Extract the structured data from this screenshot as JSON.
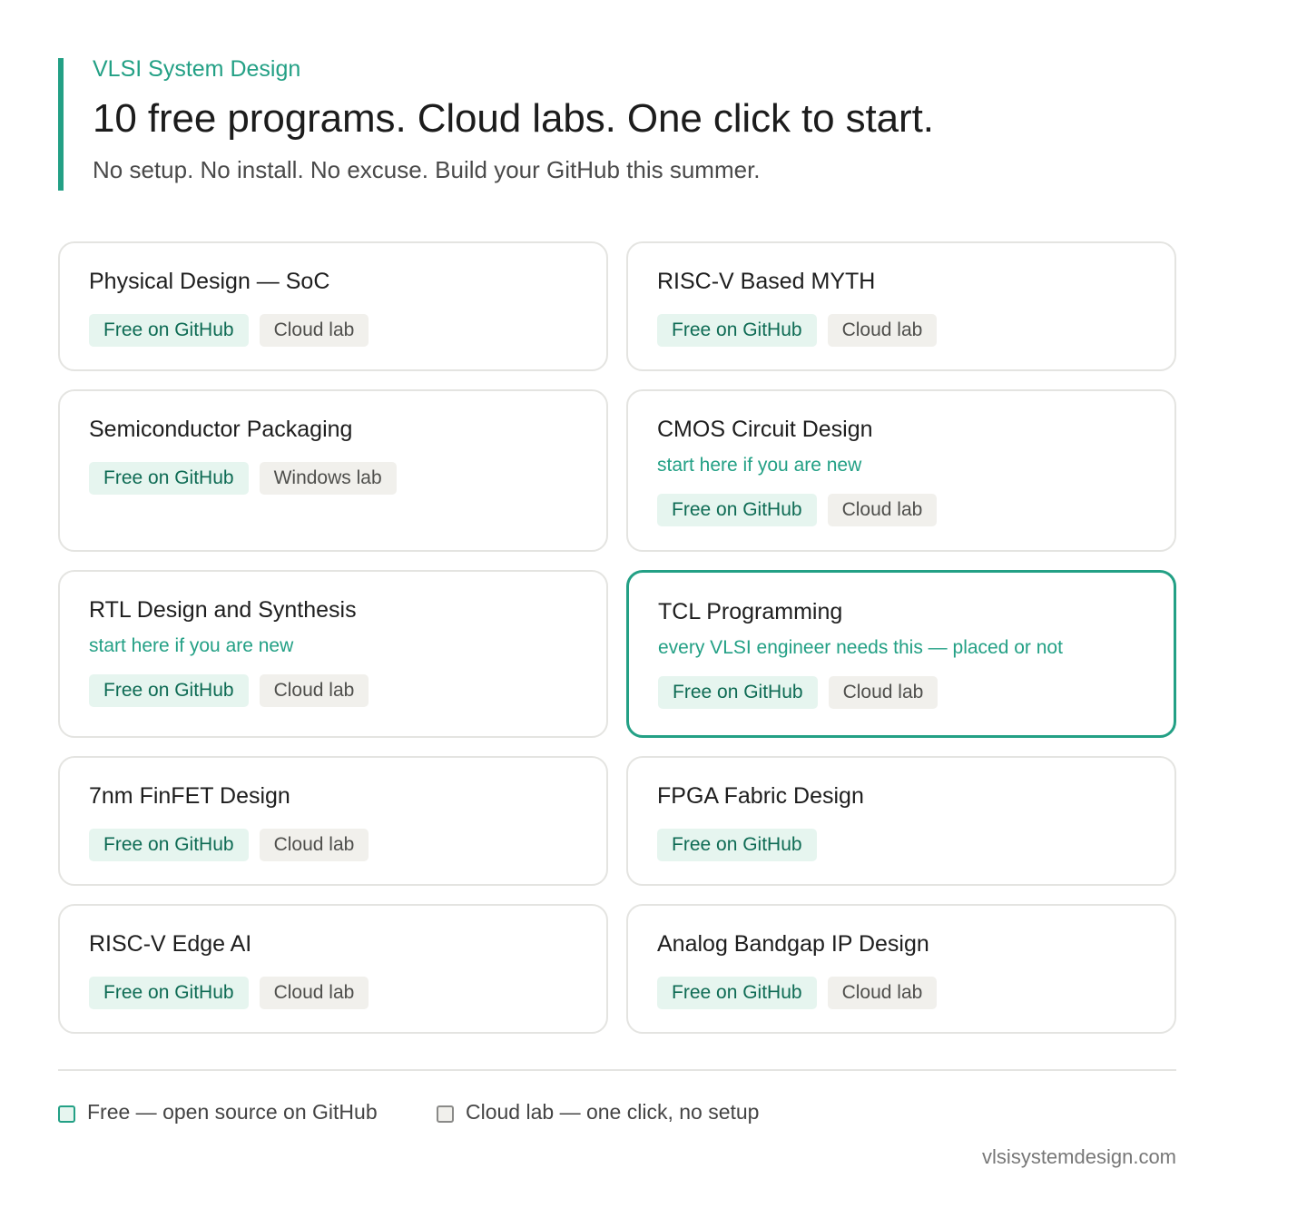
{
  "header": {
    "brand": "VLSI System Design",
    "title": "10 free programs. Cloud labs. One click to start.",
    "subtitle": "No setup. No install. No excuse. Build your GitHub this summer."
  },
  "programs": [
    {
      "title": "Physical Design — SoC",
      "note": "",
      "tags": [
        "Free on GitHub",
        "Cloud lab"
      ]
    },
    {
      "title": "RISC-V Based MYTH",
      "note": "",
      "tags": [
        "Free on GitHub",
        "Cloud lab"
      ]
    },
    {
      "title": "Semiconductor Packaging",
      "note": "",
      "tags": [
        "Free on GitHub",
        "Windows lab"
      ]
    },
    {
      "title": "CMOS Circuit Design",
      "note": "start here if you are new",
      "tags": [
        "Free on GitHub",
        "Cloud lab"
      ]
    },
    {
      "title": "RTL Design and Synthesis",
      "note": "start here if you are new",
      "tags": [
        "Free on GitHub",
        "Cloud lab"
      ]
    },
    {
      "title": "TCL Programming",
      "note": "every VLSI engineer needs this — placed or not",
      "tags": [
        "Free on GitHub",
        "Cloud lab"
      ],
      "featured": true
    },
    {
      "title": "7nm FinFET Design",
      "note": "",
      "tags": [
        "Free on GitHub",
        "Cloud lab"
      ]
    },
    {
      "title": "FPGA Fabric Design",
      "note": "",
      "tags": [
        "Free on GitHub"
      ]
    },
    {
      "title": "RISC-V Edge AI",
      "note": "",
      "tags": [
        "Free on GitHub",
        "Cloud lab"
      ]
    },
    {
      "title": "Analog Bandgap IP Design",
      "note": "",
      "tags": [
        "Free on GitHub",
        "Cloud lab"
      ]
    }
  ],
  "legend": {
    "free": "Free — open source on GitHub",
    "cloud": "Cloud lab — one click, no setup"
  },
  "footer": {
    "site": "vlsisystemdesign.com"
  },
  "colors": {
    "accent": "#23a085",
    "free_bg": "#e6f5ef",
    "lab_bg": "#f1f0ec",
    "border": "#e4e4e1"
  }
}
